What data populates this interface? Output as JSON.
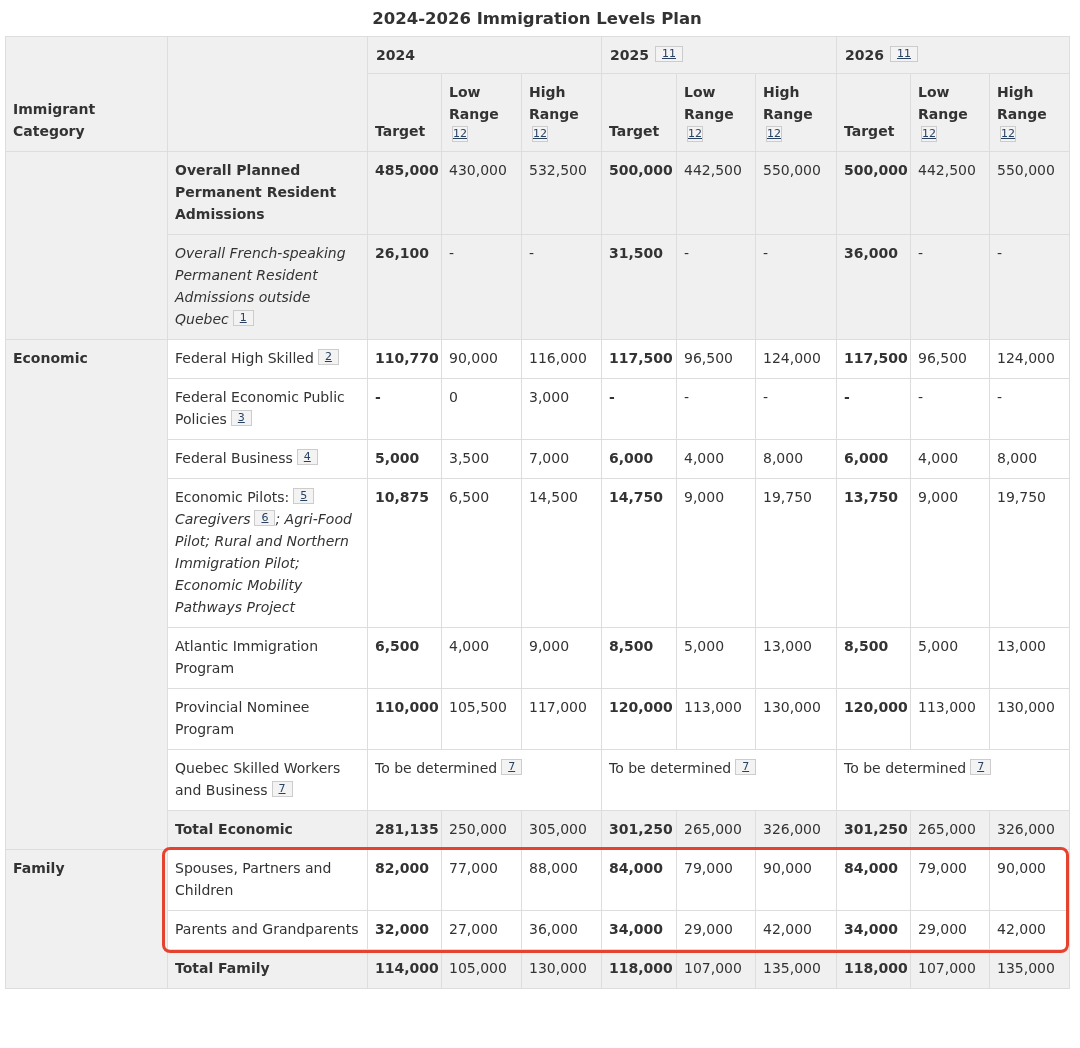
{
  "title": "2024-2026 Immigration Levels Plan",
  "header": {
    "category": "Immigrant Category",
    "years": [
      {
        "year": "2024",
        "subcolumns": [
          {
            "label": "Target"
          },
          {
            "label": "Low Range",
            "note": "12"
          },
          {
            "label": "High Range",
            "note": "12"
          }
        ]
      },
      {
        "year": "2025",
        "note": "11",
        "subcolumns": [
          {
            "label": "Target"
          },
          {
            "label": "Low Range",
            "note": "12"
          },
          {
            "label": "High Range",
            "note": "12"
          }
        ]
      },
      {
        "year": "2026",
        "note": "11",
        "subcolumns": [
          {
            "label": "Target"
          },
          {
            "label": "Low Range",
            "note": "12"
          },
          {
            "label": "High Range",
            "note": "12"
          }
        ]
      }
    ]
  },
  "groups": [
    {
      "rows": [
        {
          "label": [
            {
              "text": "Overall Planned Permanent Resident Admissions"
            }
          ],
          "kind": "bold",
          "shaded": true,
          "highlighted": false,
          "years": [
            {
              "kind": "values",
              "target": "485,000",
              "low": "430,000",
              "high": "532,500"
            },
            {
              "kind": "values",
              "target": "500,000",
              "low": "442,500",
              "high": "550,000"
            },
            {
              "kind": "values",
              "target": "500,000",
              "low": "442,500",
              "high": "550,000"
            }
          ]
        },
        {
          "label": [
            {
              "text": "Overall French-speaking Permanent Resident Admissions outside Quebec"
            },
            {
              "note": "1"
            }
          ],
          "kind": "italic",
          "shaded": true,
          "highlighted": false,
          "years": [
            {
              "kind": "values",
              "target": "26,100",
              "low": "-",
              "high": "-"
            },
            {
              "kind": "values",
              "target": "31,500",
              "low": "-",
              "high": "-"
            },
            {
              "kind": "values",
              "target": "36,000",
              "low": "-",
              "high": "-"
            }
          ]
        }
      ]
    },
    {
      "category": "Economic",
      "rows": [
        {
          "label": [
            {
              "text": "Federal High Skilled"
            },
            {
              "note": "2"
            }
          ],
          "kind": "plain",
          "shaded": false,
          "highlighted": false,
          "years": [
            {
              "kind": "values",
              "target": "110,770",
              "low": "90,000",
              "high": "116,000"
            },
            {
              "kind": "values",
              "target": "117,500",
              "low": "96,500",
              "high": "124,000"
            },
            {
              "kind": "values",
              "target": "117,500",
              "low": "96,500",
              "high": "124,000"
            }
          ]
        },
        {
          "label": [
            {
              "text": "Federal Economic Public Policies"
            },
            {
              "note": "3"
            }
          ],
          "kind": "plain",
          "shaded": false,
          "highlighted": false,
          "years": [
            {
              "kind": "values",
              "target": "-",
              "low": "0",
              "high": "3,000"
            },
            {
              "kind": "values",
              "target": "-",
              "low": "-",
              "high": "-"
            },
            {
              "kind": "values",
              "target": "-",
              "low": "-",
              "high": "-"
            }
          ]
        },
        {
          "label": [
            {
              "text": "Federal Business"
            },
            {
              "note": "4"
            }
          ],
          "kind": "plain",
          "shaded": false,
          "highlighted": false,
          "years": [
            {
              "kind": "values",
              "target": "5,000",
              "low": "3,500",
              "high": "7,000"
            },
            {
              "kind": "values",
              "target": "6,000",
              "low": "4,000",
              "high": "8,000"
            },
            {
              "kind": "values",
              "target": "6,000",
              "low": "4,000",
              "high": "8,000"
            }
          ]
        },
        {
          "label": [
            {
              "text": "Economic Pilots:"
            },
            {
              "note": "5"
            },
            {
              "text": " *Caregivers*"
            },
            {
              "note": "6"
            },
            {
              "text": "*; Agri-Food Pilot; Rural and Northern Immigration Pilot; Economic Mobility Pathways Project*"
            }
          ],
          "kind": "plain",
          "shaded": false,
          "highlighted": false,
          "years": [
            {
              "kind": "values",
              "target": "10,875",
              "low": "6,500",
              "high": "14,500"
            },
            {
              "kind": "values",
              "target": "14,750",
              "low": "9,000",
              "high": "19,750"
            },
            {
              "kind": "values",
              "target": "13,750",
              "low": "9,000",
              "high": "19,750"
            }
          ]
        },
        {
          "label": [
            {
              "text": "Atlantic Immigration Program"
            }
          ],
          "kind": "plain",
          "shaded": false,
          "highlighted": false,
          "years": [
            {
              "kind": "values",
              "target": "6,500",
              "low": "4,000",
              "high": "9,000"
            },
            {
              "kind": "values",
              "target": "8,500",
              "low": "5,000",
              "high": "13,000"
            },
            {
              "kind": "values",
              "target": "8,500",
              "low": "5,000",
              "high": "13,000"
            }
          ]
        },
        {
          "label": [
            {
              "text": "Provincial Nominee Program"
            }
          ],
          "kind": "plain",
          "shaded": false,
          "highlighted": false,
          "years": [
            {
              "kind": "values",
              "target": "110,000",
              "low": "105,500",
              "high": "117,000"
            },
            {
              "kind": "values",
              "target": "120,000",
              "low": "113,000",
              "high": "130,000"
            },
            {
              "kind": "values",
              "target": "120,000",
              "low": "113,000",
              "high": "130,000"
            }
          ]
        },
        {
          "label": [
            {
              "text": "Quebec Skilled Workers and Business"
            },
            {
              "note": "7"
            }
          ],
          "kind": "plain",
          "shaded": false,
          "highlighted": false,
          "years": [
            {
              "kind": "merged",
              "text": "To be determined",
              "note": "7"
            },
            {
              "kind": "merged",
              "text": "To be determined",
              "note": "7"
            },
            {
              "kind": "merged",
              "text": "To be determined",
              "note": "7"
            }
          ]
        },
        {
          "label": [
            {
              "text": "Total Economic"
            }
          ],
          "kind": "bold",
          "shaded": true,
          "highlighted": false,
          "years": [
            {
              "kind": "values",
              "target": "281,135",
              "low": "250,000",
              "high": "305,000"
            },
            {
              "kind": "values",
              "target": "301,250",
              "low": "265,000",
              "high": "326,000"
            },
            {
              "kind": "values",
              "target": "301,250",
              "low": "265,000",
              "high": "326,000"
            }
          ]
        }
      ]
    },
    {
      "category": "Family",
      "rows": [
        {
          "label": [
            {
              "text": "Spouses, Partners and Children"
            }
          ],
          "kind": "plain",
          "shaded": false,
          "highlighted": true,
          "years": [
            {
              "kind": "values",
              "target": "82,000",
              "low": "77,000",
              "high": "88,000"
            },
            {
              "kind": "values",
              "target": "84,000",
              "low": "79,000",
              "high": "90,000"
            },
            {
              "kind": "values",
              "target": "84,000",
              "low": "79,000",
              "high": "90,000"
            }
          ]
        },
        {
          "label": [
            {
              "text": "Parents and Grandparents"
            }
          ],
          "kind": "plain",
          "shaded": false,
          "highlighted": true,
          "years": [
            {
              "kind": "values",
              "target": "32,000",
              "low": "27,000",
              "high": "36,000"
            },
            {
              "kind": "values",
              "target": "34,000",
              "low": "29,000",
              "high": "42,000"
            },
            {
              "kind": "values",
              "target": "34,000",
              "low": "29,000",
              "high": "42,000"
            }
          ]
        },
        {
          "label": [
            {
              "text": "Total Family"
            }
          ],
          "kind": "bold",
          "shaded": true,
          "highlighted": false,
          "years": [
            {
              "kind": "values",
              "target": "114,000",
              "low": "105,000",
              "high": "130,000"
            },
            {
              "kind": "values",
              "target": "118,000",
              "low": "107,000",
              "high": "135,000"
            },
            {
              "kind": "values",
              "target": "118,000",
              "low": "107,000",
              "high": "135,000"
            }
          ]
        }
      ]
    }
  ]
}
